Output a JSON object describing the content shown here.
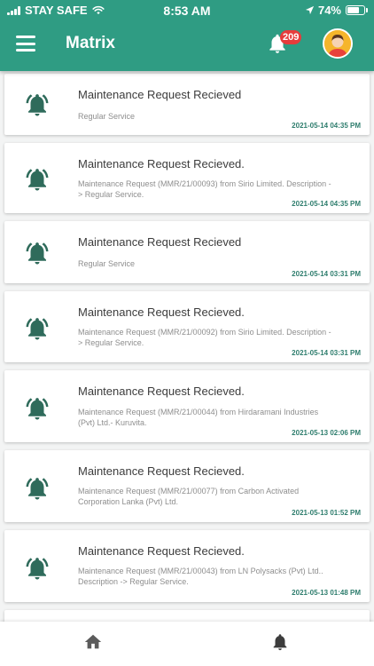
{
  "status_bar": {
    "carrier": "STAY SAFE",
    "time": "8:53 AM",
    "battery": "74%",
    "battery_level": 0.74
  },
  "header": {
    "title": "Matrix",
    "notification_count": "209",
    "menu_icon": "hamburger-menu-icon",
    "notification_icon": "bell-icon",
    "accent_color": "#2f9c83",
    "badge_color": "#e63c3c"
  },
  "notifications": [
    {
      "title": "Maintenance Request Recieved",
      "description": "Regular Service",
      "time": "2021-05-14 04:35 PM"
    },
    {
      "title": "Maintenance Request Recieved.",
      "description": "Maintenance Request (MMR/21/00093) from Sirio Limited. Description -> Regular Service.",
      "time": "2021-05-14 04:35 PM"
    },
    {
      "title": "Maintenance Request Recieved",
      "description": "Regular Service",
      "time": "2021-05-14 03:31 PM"
    },
    {
      "title": "Maintenance Request Recieved.",
      "description": "Maintenance Request (MMR/21/00092) from Sirio Limited. Description -> Regular Service.",
      "time": "2021-05-14 03:31 PM"
    },
    {
      "title": "Maintenance Request Recieved.",
      "description": "Maintenance Request (MMR/21/00044) from Hirdaramani Industries (Pvt) Ltd.- Kuruvita.",
      "time": "2021-05-13 02:06 PM"
    },
    {
      "title": "Maintenance Request Recieved.",
      "description": "Maintenance Request (MMR/21/00077) from Carbon Activated Corporation Lanka (Pvt) Ltd.",
      "time": "2021-05-13 01:52 PM"
    },
    {
      "title": "Maintenance Request Recieved.",
      "description": "Maintenance Request (MMR/21/00043) from LN Polysacks (Pvt) Ltd.. Description -> Regular Service.",
      "time": "2021-05-13 01:48 PM"
    }
  ],
  "bottom_nav": {
    "home_icon": "home-icon",
    "notifications_icon": "bell-icon",
    "active_tab": "notifications",
    "active_color": "#2196d3"
  },
  "colors": {
    "bell": "#2f6b5b",
    "time_text": "#2e7d6d"
  }
}
